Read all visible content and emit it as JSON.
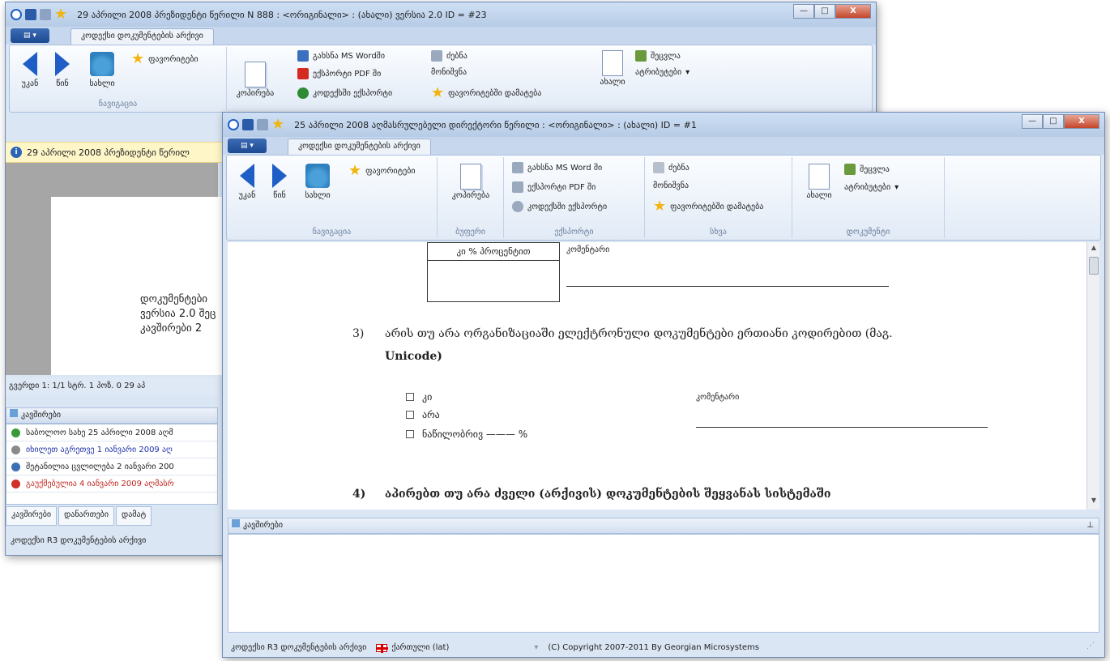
{
  "window1": {
    "title": "29 აპრილი 2008 პრეზიდენტი წერილი N 888 : <ორიგინალი> : (ახალი) ვერსია 2.0 ID = #23",
    "tab": "კოდექსი დოკუმენტების არქივი",
    "nav": {
      "back": "უკან",
      "forward": "წინ",
      "home": "სახლი",
      "favorites": "ფავორიტები",
      "group": "ნავიგაცია"
    },
    "copy": "კოპირება",
    "open_word": "გახსნა MS Wordში",
    "export_pdf": "ექსპორტი PDF ში",
    "export_codex": "კოდექსში ექსპორტი",
    "search": "ძებნა",
    "mark": "მონიშვნა",
    "add_fav": "ფავორიტებში დამატება",
    "new": "ახალი",
    "edit": "შეცვლა",
    "attributes": "ატრიბუტები",
    "infobar": "29 აპრილი 2008 პრეზიდენტი წერილ",
    "page_lines": [
      "დოკუმენტები",
      "ვერსია 2.0 შეც",
      "კავშირები 2"
    ],
    "statusline": "გვერდი 1: 1/1    სტრ. 1 პოზ. 0     29 აპ",
    "links_header": "კავშირები",
    "links": [
      {
        "text": "საბოლოო სახე 25 აპრილი 2008  აღმ",
        "color": "#3a9a3a",
        "textcolor": "#1e1e1e"
      },
      {
        "text": "იხილეთ აგრეთვე 1 იანვარი 2009  აღ",
        "color": "#8a8a8a",
        "textcolor": "#1c2fa8"
      },
      {
        "text": "შეტანილია ცვლილება 2 იანვარი 200",
        "color": "#3a6fb5",
        "textcolor": "#1e1e1e"
      },
      {
        "text": "გაუქმებულია 4 იანვარი 2009  აღმასრ",
        "color": "#d0302a",
        "textcolor": "#c0241e"
      }
    ],
    "bottom_tabs": [
      "კავშირები",
      "დანართები",
      "დამატ"
    ],
    "status": "კოდექსი R3 დოკუმენტების არქივი"
  },
  "window2": {
    "title": "25 აპრილი 2008  აღმასრულებელი დირექტორი  წერილი : <ორიგინალი> : (ახალი) ID = #1",
    "tab": "კოდექსი დოკუმენტების არქივი",
    "nav": {
      "back": "უკან",
      "forward": "წინ",
      "home": "სახლი",
      "favorites": "ფავორიტები",
      "group": "ნავიგაცია"
    },
    "copy": "კოპირება",
    "buffer_group": "ბუფერი",
    "open_word": "გახსნა MS Word ში",
    "export_pdf": "ექსპორტი PDF ში",
    "export_codex": "კოდექსში ექსპორტი",
    "export_group": "ექსპორტი",
    "search": "ძებნა",
    "mark": "მონიშვნა",
    "add_fav": "ფავორიტებში დამატება",
    "other_group": "სხვა",
    "new": "ახალი",
    "edit": "შეცვლა",
    "attributes": "ატრიბუტები",
    "doc_group": "დოკუმენტი",
    "doc": {
      "table_header": "კი % პროცენტით",
      "comment1": "კომენტარი",
      "q3_num": "3)",
      "q3_line1": "არის თუ არა ორგანიზაციაში ელექტრონული დოკუმენტები ერთიანი კოდირებით (მაგ.",
      "q3_line2": "Unicode)",
      "opt_yes": "კი",
      "opt_no": "არა",
      "opt_partial": "ნაწილობრივ ——— %",
      "comment2": "კომენტარი",
      "q4_num": "4)",
      "q4_text": "აპირებთ თუ არა ძველი (არქივის) დოკუმენტების შეყვანას სისტემაში"
    },
    "links_header": "კავშირები",
    "status": "კოდექსი R3 დოკუმენტების არქივი",
    "language": "ქართული (lat)",
    "copyright": "(C) Copyright 2007-2011 By Georgian Microsystems"
  }
}
